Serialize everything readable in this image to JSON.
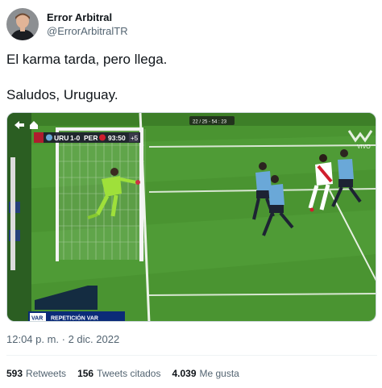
{
  "author": {
    "display_name": "Error Arbitral",
    "handle": "@ErrorArbitralTR"
  },
  "tweet": {
    "line1": "El karma tarda, pero llega.",
    "line2": "Saludos, Uruguay."
  },
  "media": {
    "scoreboard": {
      "team_home": "URU",
      "score": "1-0",
      "team_away": "PER",
      "clock": "93:50",
      "added_time": "+5"
    },
    "overlay_time": "22 / 25 - 54 : 23",
    "broadcaster_logo": "VIVO",
    "var_badge": "VAR",
    "var_label": "REPETICIÓN VAR"
  },
  "meta": {
    "timestamp": "12:04 p. m. · 2 dic. 2022"
  },
  "stats": {
    "retweets_count": "593",
    "retweets_label": "Retweets",
    "quotes_count": "156",
    "quotes_label": "Tweets citados",
    "likes_count": "4.039",
    "likes_label": "Me gusta"
  },
  "colors": {
    "pitch_light": "#4f9a35",
    "pitch_dark": "#3f8429",
    "uruguay_shirt": "#6aa8d8",
    "peru_shirt": "#ffffff",
    "keeper_shirt": "#9fe03a"
  }
}
